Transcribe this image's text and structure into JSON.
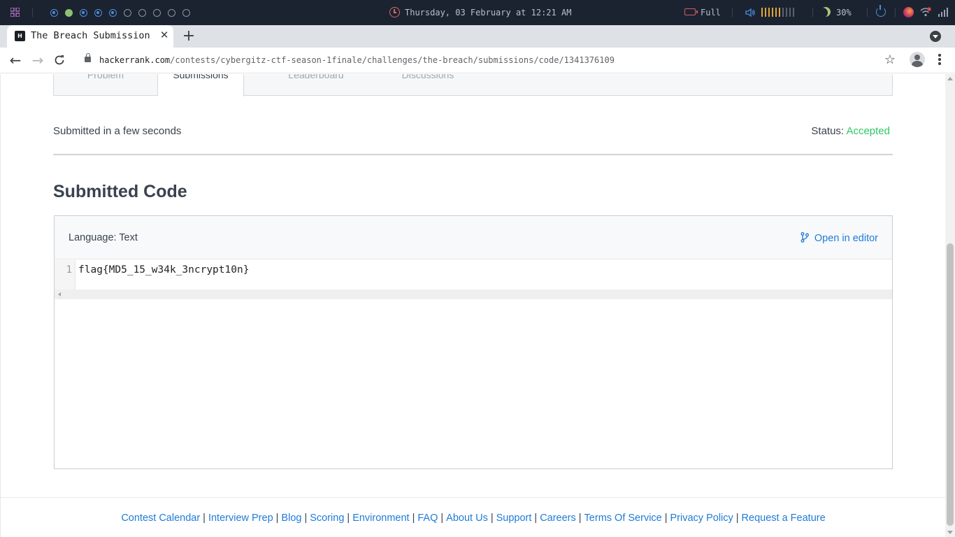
{
  "system_bar": {
    "workspaces": [
      "active",
      "current",
      "active",
      "active",
      "active",
      "empty",
      "empty",
      "empty",
      "empty",
      "empty"
    ],
    "clock": "Thursday, 03 February at 12:21 AM",
    "battery": "Full",
    "volume_level": 0.6,
    "night_light": "30%",
    "colors": {
      "background": "#1c2330",
      "accent_blue": "#4a8fe0",
      "volume": "#e0a537"
    }
  },
  "browser": {
    "tab": {
      "favicon_text": "H",
      "title": "The Breach Submission"
    },
    "url_host": "hackerrank.com",
    "url_path": "/contests/cybergitz-ctf-season-1finale/challenges/the-breach/submissions/code/1341376109"
  },
  "challenge_tabs": {
    "items": [
      "Problem",
      "Submissions",
      "Leaderboard",
      "Discussions"
    ],
    "active": "Submissions"
  },
  "submission": {
    "submitted": "Submitted in a few seconds",
    "status_label": "Status:",
    "status_value": "Accepted"
  },
  "code": {
    "title": "Submitted Code",
    "language": "Language: Text",
    "open_in_editor": "Open in editor",
    "line_numbers": [
      "1"
    ],
    "lines": [
      "flag{MD5_15_w34k_3ncrypt10n}"
    ]
  },
  "footer": {
    "links": [
      "Contest Calendar",
      "Interview Prep",
      "Blog",
      "Scoring",
      "Environment",
      "FAQ",
      "About Us",
      "Support",
      "Careers",
      "Terms Of Service",
      "Privacy Policy",
      "Request a Feature"
    ],
    "separator": "|"
  },
  "colors": {
    "link": "#1f7bd8",
    "accepted": "#2ec866",
    "text": "#39424e"
  }
}
